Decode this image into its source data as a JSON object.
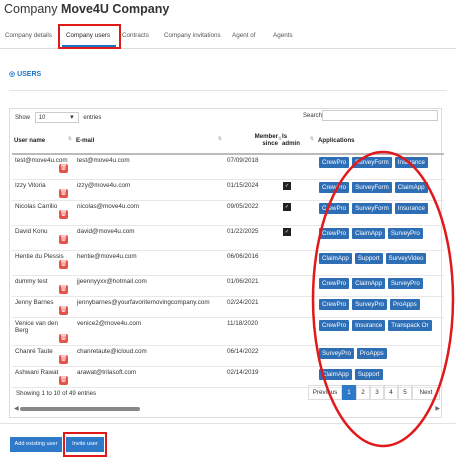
{
  "header": {
    "prefix": "Company",
    "company_name": "Move4U Company"
  },
  "tabs": [
    {
      "label": "Company details"
    },
    {
      "label": "Company users"
    },
    {
      "label": "Contracts"
    },
    {
      "label": "Company invitations"
    },
    {
      "label": "Agent of"
    },
    {
      "label": "Agents"
    }
  ],
  "section": {
    "icon": "◎",
    "title": "USERS"
  },
  "length": {
    "show": "Show",
    "value": "10",
    "entries": "entries"
  },
  "search": {
    "label": "Search:",
    "value": ""
  },
  "columns": [
    "User name",
    "E-mail",
    "Member since",
    "Is admin",
    "Applications"
  ],
  "rows": [
    {
      "name": "test@move4u.com",
      "email": "test@move4u.com",
      "since": "07/09/2018",
      "admin": false,
      "apps": [
        "CrewPro",
        "SurveyForm",
        "Insurance"
      ]
    },
    {
      "name": "Izzy Vitoria",
      "email": "izzy@move4u.com",
      "since": "01/15/2024",
      "admin": true,
      "apps": [
        "CrewPro",
        "SurveyForm",
        "ClaimApp"
      ]
    },
    {
      "name": "Nicolas Carrilio",
      "email": "nicolas@move4u.com",
      "since": "09/05/2022",
      "admin": true,
      "apps": [
        "CrewPro",
        "SurveyForm",
        "Insurance"
      ]
    },
    {
      "name": "David Konu",
      "email": "david@move4u.com",
      "since": "01/22/2025",
      "admin": true,
      "apps": [
        "CrewPro",
        "ClaimApp",
        "SurveyPro"
      ]
    },
    {
      "name": "Hentie du Plessis",
      "email": "hentie@move4u.com",
      "since": "06/06/2016",
      "admin": false,
      "apps": [
        "ClaimApp",
        "Support",
        "SurveyVideo"
      ]
    },
    {
      "name": "dummy test",
      "email": "jjeennyyxx@hotmail.com",
      "since": "01/06/2021",
      "admin": false,
      "apps": [
        "CrewPro",
        "ClaimApp",
        "SurveyPro"
      ]
    },
    {
      "name": "Jenny Barnes",
      "email": "jennybarnes@yourfavoritemovingcompany.com",
      "since": "02/24/2021",
      "admin": false,
      "apps": [
        "CrewPro",
        "SurveyPro",
        "ProApps"
      ]
    },
    {
      "name": "Venice van den Berg",
      "email": "venice2@move4u.com",
      "since": "11/18/2020",
      "admin": false,
      "apps": [
        "CrewPro",
        "Insurance",
        "Transpack Or"
      ]
    },
    {
      "name": "Chanré Taute",
      "email": "chanretaute@icloud.com",
      "since": "06/14/2022",
      "admin": false,
      "apps": [
        "SurveyPro",
        "ProApps"
      ]
    },
    {
      "name": "Ashwani Rawat",
      "email": "arawat@trilasoft.com",
      "since": "02/14/2019",
      "admin": false,
      "apps": [
        "ClaimApp",
        "Support"
      ]
    }
  ],
  "info": "Showing 1 to 10 of 49 entries",
  "pagination": {
    "previous": "Previous",
    "pages": [
      "1",
      "2",
      "3",
      "4",
      "5"
    ],
    "next": "Next"
  },
  "buttons": {
    "add_existing": "Add existing user",
    "invite": "Invite user"
  },
  "colors": {
    "accent": "#2e7ac9",
    "app_badge": "#2e6eb5",
    "delete": "#e5534b",
    "annotation": "#e0191b"
  }
}
